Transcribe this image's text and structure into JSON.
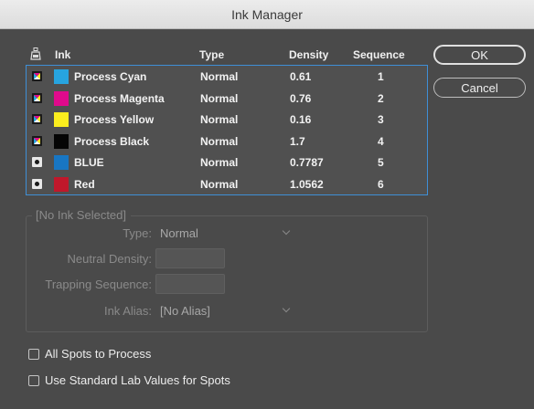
{
  "window": {
    "title": "Ink Manager"
  },
  "table": {
    "headers": {
      "icon": "ink-icon",
      "ink": "Ink",
      "type": "Type",
      "density": "Density",
      "sequence": "Sequence"
    },
    "rows": [
      {
        "icon": "process-ink-icon",
        "color": "#27a4df",
        "name": "Process Cyan",
        "type": "Normal",
        "density": "0.61",
        "sequence": "1"
      },
      {
        "icon": "process-ink-icon",
        "color": "#e00a8c",
        "name": "Process Magenta",
        "type": "Normal",
        "density": "0.76",
        "sequence": "2"
      },
      {
        "icon": "process-ink-icon",
        "color": "#fcee1e",
        "name": "Process Yellow",
        "type": "Normal",
        "density": "0.16",
        "sequence": "3"
      },
      {
        "icon": "process-ink-icon",
        "color": "#050505",
        "name": "Process Black",
        "type": "Normal",
        "density": "1.7",
        "sequence": "4"
      },
      {
        "icon": "spot-ink-icon",
        "color": "#1876c3",
        "name": "BLUE",
        "type": "Normal",
        "density": "0.7787",
        "sequence": "5"
      },
      {
        "icon": "spot-ink-icon",
        "color": "#c0182b",
        "name": "Red",
        "type": "Normal",
        "density": "1.0562",
        "sequence": "6"
      }
    ]
  },
  "buttons": {
    "ok": "OK",
    "cancel": "Cancel"
  },
  "details": {
    "title": "[No Ink Selected]",
    "type_label": "Type:",
    "type_value": "Normal",
    "neutral_density_label": "Neutral Density:",
    "trapping_sequence_label": "Trapping Sequence:",
    "ink_alias_label": "Ink Alias:",
    "ink_alias_value": "[No Alias]"
  },
  "options": {
    "all_spots_to_process": "All Spots to Process",
    "use_standard_lab": "Use Standard Lab Values for Spots"
  }
}
